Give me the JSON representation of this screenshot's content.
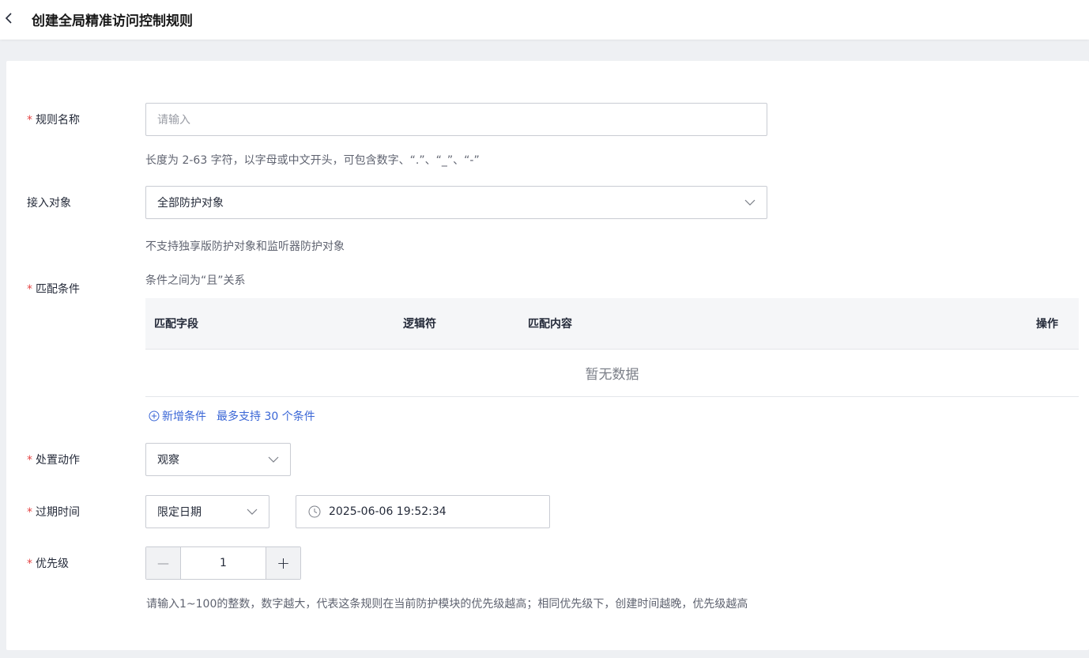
{
  "header": {
    "title": "创建全局精准访问控制规则",
    "back_icon": "chevron-left-icon"
  },
  "form": {
    "rule_name": {
      "label": "规则名称",
      "required": true,
      "value": "",
      "placeholder": "请输入",
      "hint": "长度为 2-63 字符，以字母或中文开头，可包含数字、“.”、“_”、“-”"
    },
    "access_object": {
      "label": "接入对象",
      "required": false,
      "value": "全部防护对象",
      "hint": "不支持独享版防护对象和监听器防护对象"
    },
    "match_conditions": {
      "label": "匹配条件",
      "required": true,
      "note": "条件之间为“且”关系",
      "columns": [
        "匹配字段",
        "逻辑符",
        "匹配内容",
        "操作"
      ],
      "rows": [],
      "empty_text": "暂无数据",
      "add_label": "新增条件",
      "max_note": "最多支持 30 个条件"
    },
    "action": {
      "label": "处置动作",
      "required": true,
      "value": "观察"
    },
    "expire_time": {
      "label": "过期时间",
      "required": true,
      "mode_value": "限定日期",
      "datetime_value": "2025-06-06 19:52:34"
    },
    "priority": {
      "label": "优先级",
      "required": true,
      "value": "1",
      "minus_symbol": "—",
      "plus_symbol": "+",
      "hint": "请输入1~100的整数，数字越大，代表这条规则在当前防护模块的优先级越高；相同优先级下，创建时间越晚，优先级越高"
    }
  },
  "colors": {
    "required_mark": "#e54545",
    "link": "#3a66d6",
    "border": "#c9ccd3"
  }
}
